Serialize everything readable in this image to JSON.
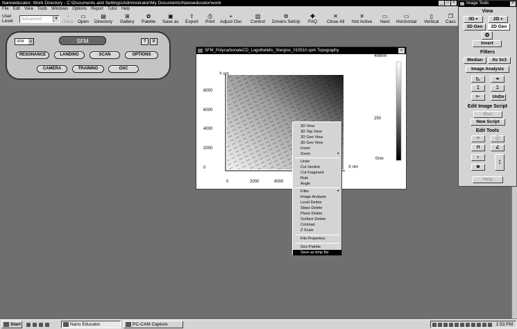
{
  "window": {
    "title": "Nanoeducator; Work Directory - C:\\Documents and Settings\\Administrator\\My Documents\\Nanoeducator\\work",
    "controls": [
      "_",
      "□",
      "×"
    ]
  },
  "menu": [
    "File",
    "Edit",
    "View",
    "Tools",
    "Windows",
    "Options",
    "Report",
    "Tutor",
    "Help"
  ],
  "toolbar": {
    "user_level_label": "User Level",
    "user_level_value": "Advanced",
    "buttons": [
      {
        "label": "Save",
        "icon": "floppy-icon",
        "disabled": true
      },
      {
        "label": "Open",
        "icon": "folder-open-icon"
      },
      {
        "label": "Directory",
        "icon": "directory-icon"
      },
      {
        "label": "Gallery",
        "icon": "gallery-icon"
      },
      {
        "label": "Palette",
        "icon": "palette-icon"
      },
      {
        "label": "Save as",
        "icon": "save-as-icon"
      },
      {
        "label": "Export",
        "icon": "export-icon"
      },
      {
        "label": "Print",
        "icon": "printer-icon"
      },
      {
        "label": "Adjust Osc",
        "icon": "adjust-osc-icon"
      },
      {
        "label": "Control",
        "icon": "control-icon"
      },
      {
        "label": "Drivers SetUp",
        "icon": "drivers-setup-icon"
      },
      {
        "label": "FAQ",
        "icon": "faq-plus-icon"
      },
      {
        "label": "Close All",
        "icon": "close-all-icon"
      },
      {
        "label": "Not Active",
        "icon": "not-active-icon"
      },
      {
        "label": "Next",
        "icon": "next-icon"
      },
      {
        "label": "Horizontal",
        "icon": "horizontal-tile-icon"
      },
      {
        "label": "Vertical",
        "icon": "vertical-tile-icon"
      },
      {
        "label": "Casc",
        "icon": "cascade-icon"
      }
    ]
  },
  "sfm_panel": {
    "select_value": "SFM",
    "title": "SFM",
    "help_label": "?",
    "close_label": "X",
    "buttons_row1": [
      "RESONANCE",
      "LANDING",
      "SCAN",
      "OPTIONS"
    ],
    "buttons_row2": [
      "CAMERA",
      "TRAINING",
      "OSC"
    ]
  },
  "topo_window": {
    "title": "SFM_PolycarbonateCD_Logothetidis_Stergios_010510.spm  Topography",
    "close": "×",
    "y_axis_label": "Y nm",
    "x_axis_label": "X nm",
    "y_ticks": [
      "8000",
      "6000",
      "4000",
      "2000",
      "0"
    ],
    "x_ticks": [
      "0",
      "2000",
      "4000"
    ],
    "colorbar_labels": [
      "499nm",
      "250",
      "0nm"
    ]
  },
  "context_menu": {
    "items": [
      {
        "label": "3D View"
      },
      {
        "label": "3D Top View"
      },
      {
        "label": "2D Geo View"
      },
      {
        "label": "3D Geo View"
      },
      {
        "label": "Invert"
      },
      {
        "label": "Zoom",
        "submenu": true
      },
      {
        "separator": true
      },
      {
        "label": "Undo"
      },
      {
        "label": "Cut Section"
      },
      {
        "label": "Cut Fragment"
      },
      {
        "label": "Rule"
      },
      {
        "label": "Angle"
      },
      {
        "separator": true
      },
      {
        "label": "Filter",
        "submenu": true
      },
      {
        "label": "Image Analysis"
      },
      {
        "label": "Level Delete"
      },
      {
        "label": "Steps Delete"
      },
      {
        "label": "Plane Delete"
      },
      {
        "label": "Surface Delete"
      },
      {
        "label": "Contrast"
      },
      {
        "label": "Z Scale"
      },
      {
        "separator": true
      },
      {
        "label": "File Properties"
      },
      {
        "separator": true
      },
      {
        "label": "Geo Palette"
      },
      {
        "label": "Save as bmp file",
        "highlighted": true
      }
    ],
    "submenu_arrow": "▸"
  },
  "image_tools": {
    "title": "Image Tools",
    "close": "×",
    "view_header": "View",
    "view_buttons": [
      "3D",
      "2D",
      "3D Geo",
      "2D Geo"
    ],
    "invert_label": "Invert",
    "filters_header": "Filters",
    "median_label": "Median",
    "av_label": "Av 3x3",
    "image_analysis_label": "Image Analysis",
    "undo_label": "UnDo",
    "edit_script_header": "Edit Image Script",
    "run_label": "Run",
    "new_script_label": "New Script",
    "edit_tools_header": "Edit Tools",
    "help_label": "Help"
  },
  "taskbar": {
    "start_label": "Start",
    "tasks": [
      "Nano Educator",
      "PC-CAM Capture"
    ],
    "clock": "1:53 PM"
  }
}
